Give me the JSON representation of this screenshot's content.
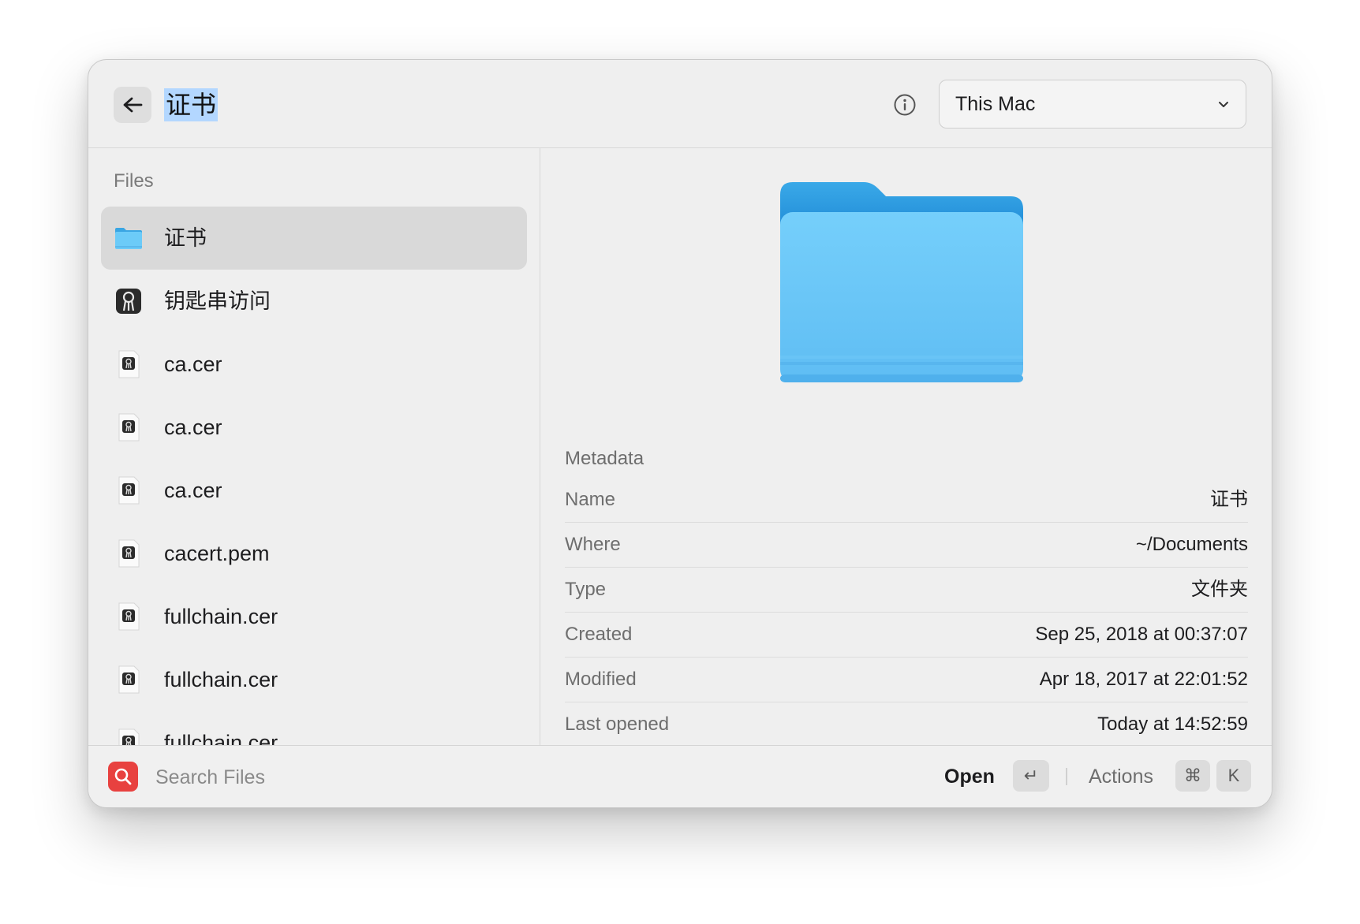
{
  "header": {
    "title": "证书",
    "scope": "This Mac"
  },
  "sidebar": {
    "section_label": "Files",
    "items": [
      {
        "label": "证书",
        "icon": "folder-icon",
        "selected": true
      },
      {
        "label": "钥匙串访问",
        "icon": "keychain-access-icon"
      },
      {
        "label": "ca.cer",
        "icon": "certificate-file-icon"
      },
      {
        "label": "ca.cer",
        "icon": "certificate-file-icon"
      },
      {
        "label": "ca.cer",
        "icon": "certificate-file-icon"
      },
      {
        "label": "cacert.pem",
        "icon": "certificate-file-icon"
      },
      {
        "label": "fullchain.cer",
        "icon": "certificate-file-icon"
      },
      {
        "label": "fullchain.cer",
        "icon": "certificate-file-icon"
      },
      {
        "label": "fullchain.cer",
        "icon": "certificate-file-icon"
      }
    ]
  },
  "preview": {
    "icon": "folder-icon",
    "metadata_title": "Metadata",
    "rows": [
      {
        "key": "Name",
        "value": "证书"
      },
      {
        "key": "Where",
        "value": "~/Documents"
      },
      {
        "key": "Type",
        "value": "文件夹"
      },
      {
        "key": "Created",
        "value": "Sep 25, 2018 at 00:37:07"
      },
      {
        "key": "Modified",
        "value": "Apr 18, 2017 at 22:01:52"
      },
      {
        "key": "Last opened",
        "value": "Today at 14:52:59"
      }
    ]
  },
  "footer": {
    "search_placeholder": "Search Files",
    "search_value": "",
    "open_label": "Open",
    "open_key": "↵",
    "actions_label": "Actions",
    "actions_keys": [
      "⌘",
      "K"
    ]
  },
  "colors": {
    "accent_search": "#e8413f",
    "selection": "#b3d7ff",
    "folder_blue": "#6ccbf8"
  }
}
